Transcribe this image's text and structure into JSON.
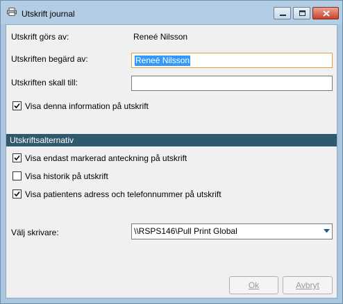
{
  "window": {
    "title": "Utskrift journal",
    "icon": "printer-icon",
    "controls": [
      "minimize-icon",
      "maximize-icon",
      "close-icon"
    ]
  },
  "form": {
    "printed_by_label": "Utskrift görs av:",
    "printed_by_value": "Reneé Nilsson",
    "requested_by_label": "Utskriften begärd av:",
    "requested_by_value": "Reneé Nilsson",
    "recipient_label": "Utskriften skall till:",
    "recipient_value": "",
    "show_info_label": "Visa denna information på utskrift",
    "show_info_checked": true
  },
  "options": {
    "header": "Utskriftsalternativ",
    "items": [
      {
        "label": "Visa endast markerad anteckning på utskrift",
        "checked": true
      },
      {
        "label": "Visa historik på utskrift",
        "checked": false
      },
      {
        "label": "Visa patientens adress och telefonnummer på utskrift",
        "checked": true
      }
    ]
  },
  "printer": {
    "label": "Välj skrivare:",
    "selected": "\\\\RSPS146\\Pull Print Global"
  },
  "buttons": {
    "ok": "Ok",
    "cancel": "Avbryt"
  },
  "colors": {
    "frame": "#a9c5df",
    "section_bar": "#2f5a6e",
    "selection": "#3399ff",
    "focus_border": "#e3a23b"
  }
}
